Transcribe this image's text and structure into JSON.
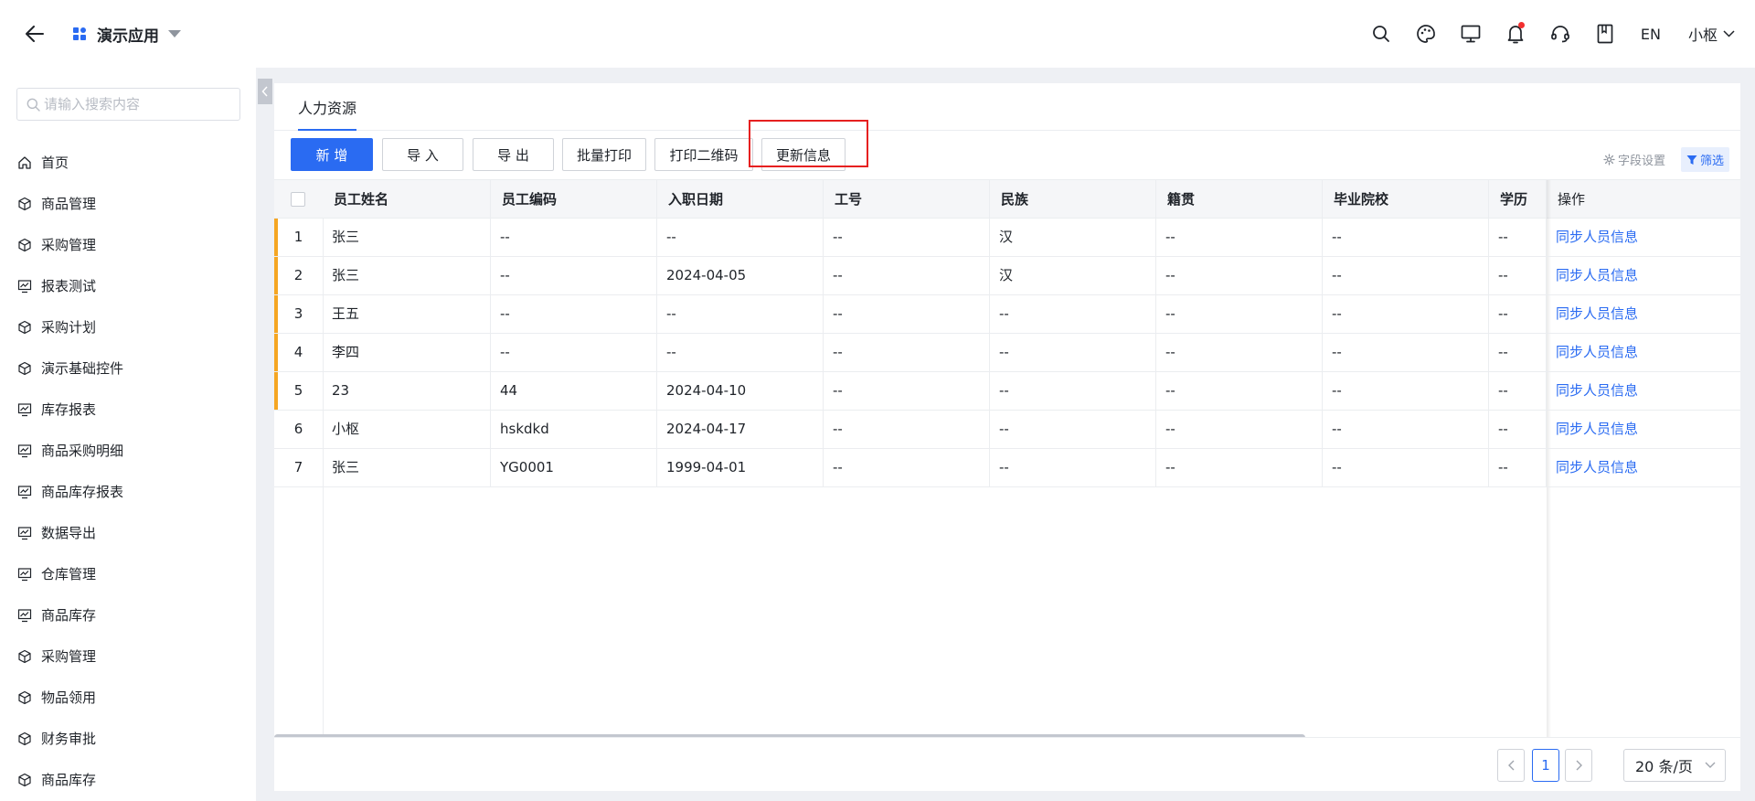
{
  "header": {
    "app_title": "演示应用",
    "lang": "EN",
    "user": "小枢",
    "icons": [
      "search-icon",
      "palette-icon",
      "monitor-icon",
      "bell-icon",
      "headset-icon",
      "book-icon"
    ]
  },
  "sidebar": {
    "search_placeholder": "请输入搜索内容",
    "items": [
      {
        "label": "首页",
        "icon": "home-icon"
      },
      {
        "label": "商品管理",
        "icon": "cube-icon"
      },
      {
        "label": "采购管理",
        "icon": "cube-icon"
      },
      {
        "label": "报表测试",
        "icon": "chart-icon"
      },
      {
        "label": "采购计划",
        "icon": "cube-icon"
      },
      {
        "label": "演示基础控件",
        "icon": "cube-icon"
      },
      {
        "label": "库存报表",
        "icon": "chart-icon"
      },
      {
        "label": "商品采购明细",
        "icon": "chart-icon"
      },
      {
        "label": "商品库存报表",
        "icon": "chart-icon"
      },
      {
        "label": "数据导出",
        "icon": "chart-icon"
      },
      {
        "label": "仓库管理",
        "icon": "chart-icon"
      },
      {
        "label": "商品库存",
        "icon": "chart-icon"
      },
      {
        "label": "采购管理",
        "icon": "cube-icon"
      },
      {
        "label": "物品领用",
        "icon": "cube-icon"
      },
      {
        "label": "财务审批",
        "icon": "cube-icon"
      },
      {
        "label": "商品库存",
        "icon": "cube-icon"
      }
    ]
  },
  "tabs": [
    "人力资源"
  ],
  "toolbar": {
    "add": "新 增",
    "import": "导 入",
    "export": "导 出",
    "batch_print": "批量打印",
    "print_qr": "打印二维码",
    "update_info": "更新信息",
    "field_settings": "字段设置",
    "filter": "筛选"
  },
  "table": {
    "columns": [
      "员工姓名",
      "员工编码",
      "入职日期",
      "工号",
      "民族",
      "籍贯",
      "毕业院校",
      "学历",
      "操作"
    ],
    "rows": [
      {
        "index": "1",
        "name": "张三",
        "code": "--",
        "date": "--",
        "work_no": "--",
        "ethnic": "汉",
        "native": "--",
        "school": "--",
        "edu": "--",
        "action": "同步人员信息",
        "marked": true
      },
      {
        "index": "2",
        "name": "张三",
        "code": "--",
        "date": "2024-04-05",
        "work_no": "--",
        "ethnic": "汉",
        "native": "--",
        "school": "--",
        "edu": "--",
        "action": "同步人员信息",
        "marked": true
      },
      {
        "index": "3",
        "name": "王五",
        "code": "--",
        "date": "--",
        "work_no": "--",
        "ethnic": "--",
        "native": "--",
        "school": "--",
        "edu": "--",
        "action": "同步人员信息",
        "marked": true
      },
      {
        "index": "4",
        "name": "李四",
        "code": "--",
        "date": "--",
        "work_no": "--",
        "ethnic": "--",
        "native": "--",
        "school": "--",
        "edu": "--",
        "action": "同步人员信息",
        "marked": true
      },
      {
        "index": "5",
        "name": "23",
        "code": "44",
        "date": "2024-04-10",
        "work_no": "--",
        "ethnic": "--",
        "native": "--",
        "school": "--",
        "edu": "--",
        "action": "同步人员信息",
        "marked": true
      },
      {
        "index": "6",
        "name": "小枢",
        "code": "hskdkd",
        "date": "2024-04-17",
        "work_no": "--",
        "ethnic": "--",
        "native": "--",
        "school": "--",
        "edu": "--",
        "action": "同步人员信息",
        "marked": false
      },
      {
        "index": "7",
        "name": "张三",
        "code": "YG0001",
        "date": "1999-04-01",
        "work_no": "--",
        "ethnic": "--",
        "native": "--",
        "school": "--",
        "edu": "--",
        "action": "同步人员信息",
        "marked": false
      }
    ]
  },
  "pagination": {
    "current": "1",
    "page_size": "20 条/页"
  },
  "colors": {
    "primary": "#2a6bf2",
    "row_marker": "#f5a623",
    "highlight": "#e62020"
  }
}
